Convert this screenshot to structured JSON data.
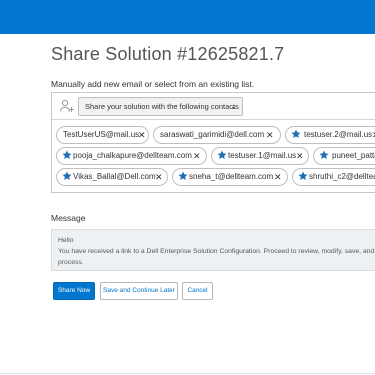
{
  "header": {
    "title": "Share Solution #12625821.7"
  },
  "instructions": "Manually add new email or select from an existing list.",
  "contacts": {
    "icon": "contacts-icon",
    "select_label": "Share your solution with the following contacts",
    "chips": [
      {
        "label": "TestUserUS@mail.us",
        "starred": false
      },
      {
        "label": "saraswati_garimidi@dell.com",
        "starred": false
      },
      {
        "label": "testuser.2@mail.us",
        "starred": true
      },
      {
        "label": "pooja_chalkapure@dellteam.com",
        "starred": true
      },
      {
        "label": "testuser.1@mail.us",
        "starred": true
      },
      {
        "label": "puneet_patta",
        "starred": true
      },
      {
        "label": "Vikas_Ballal@Dell.com",
        "starred": true
      },
      {
        "label": "sneha_t@dellteam.com",
        "starred": true
      },
      {
        "label": "shruthi_c2@dellteam",
        "starred": true
      }
    ],
    "remove_glyph": "✕"
  },
  "message": {
    "label": "Message",
    "line1": "Hello",
    "line2": "You have received a link to a Dell Enterprise Solution Configuration. Proceed to review, modify, save, and",
    "line3": "process."
  },
  "actions": {
    "share": "Share Now",
    "save_continue": "Save and Continue Later",
    "cancel": "Cancel"
  },
  "colors": {
    "brand": "#0076ce",
    "star": "#1f6fb5"
  }
}
